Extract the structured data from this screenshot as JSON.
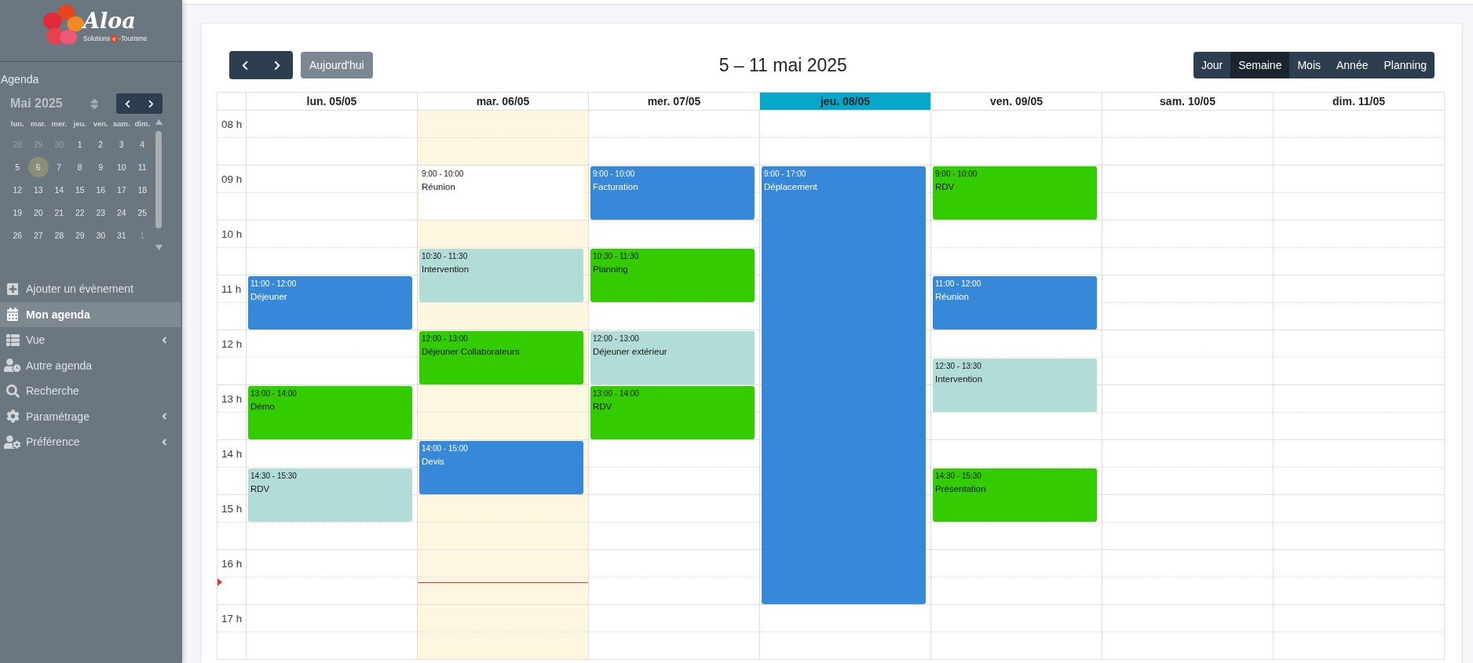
{
  "sidebar": {
    "logo": {
      "wordmark": "Aloa",
      "tagline_start": "Solutions",
      "tagline_badge": "e",
      "tagline_end": "-Tourisme"
    },
    "section_title": "Agenda",
    "mini_calendar": {
      "title": "Mai 2025",
      "weekdays": [
        "lun.",
        "mar.",
        "mer.",
        "jeu.",
        "ven.",
        "sam.",
        "dim."
      ],
      "weeks": [
        [
          {
            "day": "28",
            "outside": true,
            "selected": false
          },
          {
            "day": "29",
            "outside": true,
            "selected": false
          },
          {
            "day": "30",
            "outside": true,
            "selected": false
          },
          {
            "day": "1",
            "outside": false,
            "selected": false
          },
          {
            "day": "2",
            "outside": false,
            "selected": false
          },
          {
            "day": "3",
            "outside": false,
            "selected": false
          },
          {
            "day": "4",
            "outside": false,
            "selected": false
          }
        ],
        [
          {
            "day": "5",
            "outside": false,
            "selected": false
          },
          {
            "day": "6",
            "outside": false,
            "selected": true
          },
          {
            "day": "7",
            "outside": false,
            "selected": false
          },
          {
            "day": "8",
            "outside": false,
            "selected": false
          },
          {
            "day": "9",
            "outside": false,
            "selected": false
          },
          {
            "day": "10",
            "outside": false,
            "selected": false
          },
          {
            "day": "11",
            "outside": false,
            "selected": false
          }
        ],
        [
          {
            "day": "12",
            "outside": false,
            "selected": false
          },
          {
            "day": "13",
            "outside": false,
            "selected": false
          },
          {
            "day": "14",
            "outside": false,
            "selected": false
          },
          {
            "day": "15",
            "outside": false,
            "selected": false
          },
          {
            "day": "16",
            "outside": false,
            "selected": false
          },
          {
            "day": "17",
            "outside": false,
            "selected": false
          },
          {
            "day": "18",
            "outside": false,
            "selected": false
          }
        ],
        [
          {
            "day": "19",
            "outside": false,
            "selected": false
          },
          {
            "day": "20",
            "outside": false,
            "selected": false
          },
          {
            "day": "21",
            "outside": false,
            "selected": false
          },
          {
            "day": "22",
            "outside": false,
            "selected": false
          },
          {
            "day": "23",
            "outside": false,
            "selected": false
          },
          {
            "day": "24",
            "outside": false,
            "selected": false
          },
          {
            "day": "25",
            "outside": false,
            "selected": false
          }
        ],
        [
          {
            "day": "26",
            "outside": false,
            "selected": false
          },
          {
            "day": "27",
            "outside": false,
            "selected": false
          },
          {
            "day": "28",
            "outside": false,
            "selected": false
          },
          {
            "day": "29",
            "outside": false,
            "selected": false
          },
          {
            "day": "30",
            "outside": false,
            "selected": false
          },
          {
            "day": "31",
            "outside": false,
            "selected": false
          },
          {
            "day": "1",
            "outside": true,
            "selected": false
          }
        ]
      ]
    },
    "menu": [
      {
        "label": "Ajouter un évènement",
        "kind": "link",
        "selected": false
      },
      {
        "label": "Mon agenda",
        "kind": "link",
        "selected": true
      },
      {
        "label": "Vue",
        "kind": "submenu",
        "selected": false
      },
      {
        "label": "Autre agenda",
        "kind": "link",
        "selected": false
      },
      {
        "label": "Recherche",
        "kind": "link",
        "selected": false
      },
      {
        "label": "Paramétrage",
        "kind": "submenu",
        "selected": false
      },
      {
        "label": "Préférence",
        "kind": "submenu",
        "selected": false
      }
    ]
  },
  "calendar": {
    "toolbar": {
      "today_button": {
        "label": "Aujourd'hui",
        "disabled": true
      },
      "title": "5 – 11 mai 2025",
      "views": [
        {
          "label": "Jour",
          "selected": false
        },
        {
          "label": "Semaine",
          "selected": true
        },
        {
          "label": "Mois",
          "selected": false
        },
        {
          "label": "Année",
          "selected": false
        },
        {
          "label": "Planning",
          "selected": false
        }
      ]
    },
    "hours": [
      "08 h",
      "09 h",
      "10 h",
      "11 h",
      "12 h",
      "13 h",
      "14 h",
      "15 h",
      "16 h",
      "17 h"
    ],
    "days": [
      {
        "label": "lun. 05/05",
        "selected": false,
        "today": false,
        "events": [
          {
            "time": "11:00 - 12:00",
            "title": "Déjeuner",
            "color": "#3788d8"
          },
          {
            "time": "13:00 - 14:00",
            "title": "Démo",
            "color": "#33cc00"
          },
          {
            "time": "14:30 - 15:30",
            "title": "RDV",
            "color": "#b2dcd7"
          }
        ]
      },
      {
        "label": "mar. 06/05",
        "selected": false,
        "today": true,
        "events": [
          {
            "time": "9:00 - 10:00",
            "title": "Réunion",
            "color": "#ffffff"
          },
          {
            "time": "10:30 - 11:30",
            "title": "Intervention",
            "color": "#b2dcd7"
          },
          {
            "time": "12:00 - 13:00",
            "title": "Déjeuner Collaborateurs",
            "color": "#33cc00"
          },
          {
            "time": "14:00 - 15:00",
            "title": "Devis",
            "color": "#3788d8"
          }
        ]
      },
      {
        "label": "mer. 07/05",
        "selected": false,
        "today": false,
        "events": [
          {
            "time": "9:00 - 10:00",
            "title": "Facturation",
            "color": "#3788d8"
          },
          {
            "time": "10:30 - 11:30",
            "title": "Planning",
            "color": "#33cc00"
          },
          {
            "time": "12:00 - 13:00",
            "title": "Déjeuner extérieur",
            "color": "#b2dcd7"
          },
          {
            "time": "13:00 - 14:00",
            "title": "RDV",
            "color": "#33cc00"
          }
        ]
      },
      {
        "label": "jeu. 08/05",
        "selected": true,
        "today": false,
        "events": [
          {
            "time": "9:00 - 17:00",
            "title": "Déplacement",
            "color": "#3788d8"
          }
        ]
      },
      {
        "label": "ven. 09/05",
        "selected": false,
        "today": false,
        "events": [
          {
            "time": "9:00 - 10:00",
            "title": "RDV",
            "color": "#33cc00"
          },
          {
            "time": "11:00 - 12:00",
            "title": "Réunion",
            "color": "#3788d8"
          },
          {
            "time": "12:30 - 13:30",
            "title": "Intervention",
            "color": "#b2dcd7"
          },
          {
            "time": "14:30 - 15:30",
            "title": "Présentation",
            "color": "#33cc00"
          }
        ]
      },
      {
        "label": "sam. 10/05",
        "selected": false,
        "today": false
      },
      {
        "label": "dim. 11/05",
        "selected": false,
        "today": false
      }
    ]
  }
}
